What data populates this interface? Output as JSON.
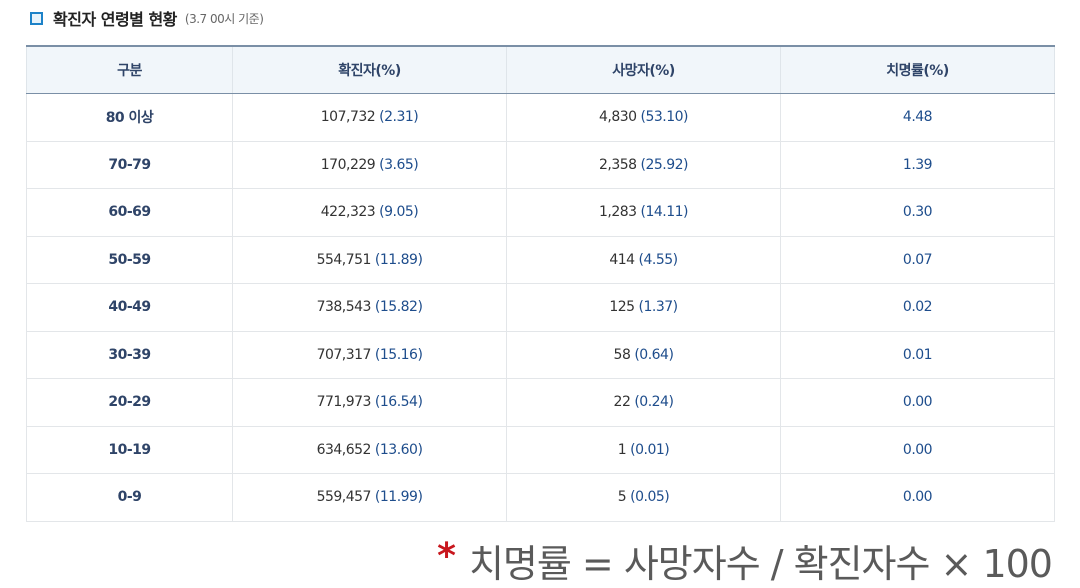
{
  "header": {
    "title": "확진자 연령별 현황",
    "subtitle": "(3.7 00시 기준)",
    "icon": "square-bullet-icon",
    "accent_color": "#1d82c8"
  },
  "table": {
    "columns": [
      "구분",
      "확진자(%)",
      "사망자(%)",
      "치명률(%)"
    ],
    "rows": [
      {
        "age": "80 이상",
        "confirmed": "107,732",
        "confirmed_pct": "(2.31)",
        "deaths": "4,830",
        "deaths_pct": "(53.10)",
        "fatality": "4.48"
      },
      {
        "age": "70-79",
        "confirmed": "170,229",
        "confirmed_pct": "(3.65)",
        "deaths": "2,358",
        "deaths_pct": "(25.92)",
        "fatality": "1.39"
      },
      {
        "age": "60-69",
        "confirmed": "422,323",
        "confirmed_pct": "(9.05)",
        "deaths": "1,283",
        "deaths_pct": "(14.11)",
        "fatality": "0.30"
      },
      {
        "age": "50-59",
        "confirmed": "554,751",
        "confirmed_pct": "(11.89)",
        "deaths": "414",
        "deaths_pct": "(4.55)",
        "fatality": "0.07"
      },
      {
        "age": "40-49",
        "confirmed": "738,543",
        "confirmed_pct": "(15.82)",
        "deaths": "125",
        "deaths_pct": "(1.37)",
        "fatality": "0.02"
      },
      {
        "age": "30-39",
        "confirmed": "707,317",
        "confirmed_pct": "(15.16)",
        "deaths": "58",
        "deaths_pct": "(0.64)",
        "fatality": "0.01"
      },
      {
        "age": "20-29",
        "confirmed": "771,973",
        "confirmed_pct": "(16.54)",
        "deaths": "22",
        "deaths_pct": "(0.24)",
        "fatality": "0.00"
      },
      {
        "age": "10-19",
        "confirmed": "634,652",
        "confirmed_pct": "(13.60)",
        "deaths": "1",
        "deaths_pct": "(0.01)",
        "fatality": "0.00"
      },
      {
        "age": "0-9",
        "confirmed": "559,457",
        "confirmed_pct": "(11.99)",
        "deaths": "5",
        "deaths_pct": "(0.05)",
        "fatality": "0.00"
      }
    ]
  },
  "footnote": {
    "star": "*",
    "formula": "치명률 = 사망자수 / 확진자수 × 100",
    "star_color": "#c8161d"
  }
}
